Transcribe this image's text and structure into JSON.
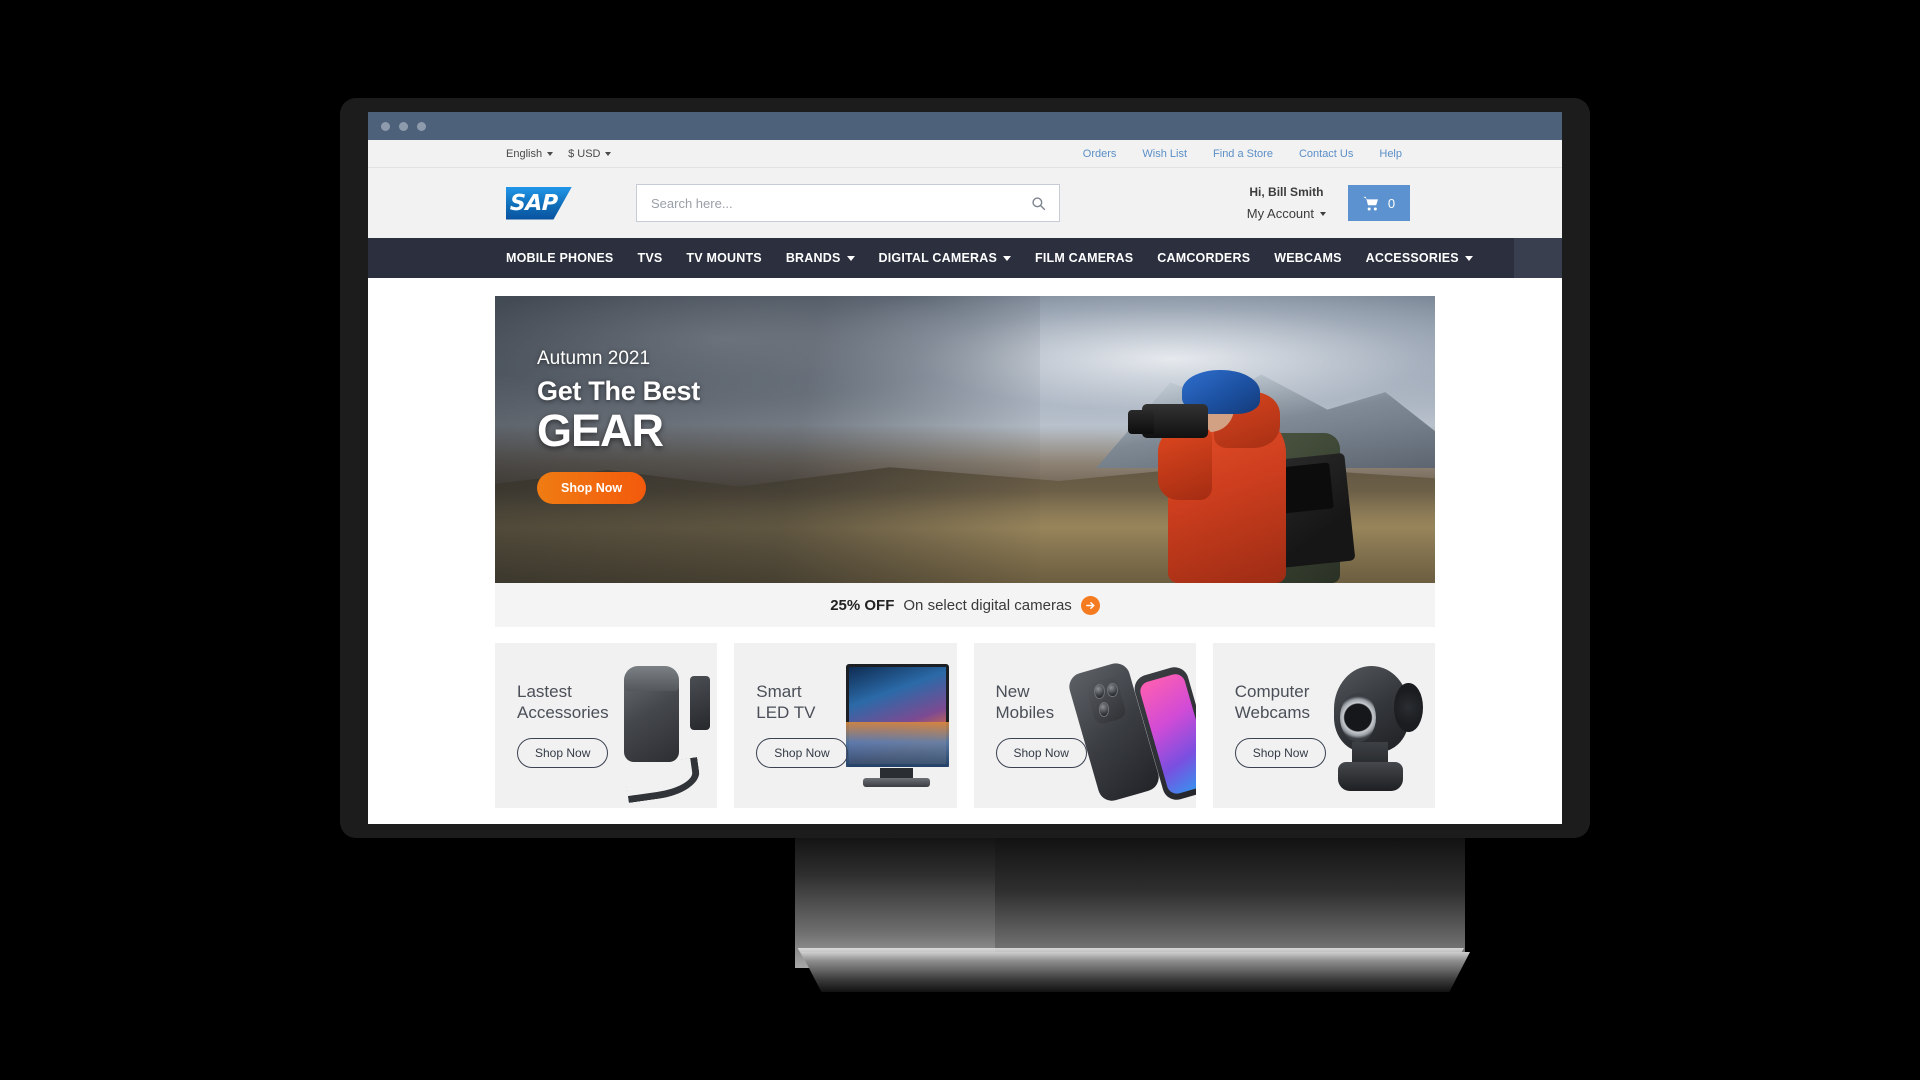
{
  "window": {
    "dots": [
      "close-dot",
      "minimize-dot",
      "maximize-dot"
    ]
  },
  "utility_bar": {
    "language": "English",
    "currency": "$ USD",
    "links": [
      {
        "label": "Orders"
      },
      {
        "label": "Wish List"
      },
      {
        "label": "Find a Store"
      },
      {
        "label": "Contact Us"
      },
      {
        "label": "Help"
      }
    ],
    "link_color": "#5b8fc7"
  },
  "header": {
    "logo_text": "SAP",
    "search": {
      "placeholder": "Search here...",
      "value": "",
      "icon": "search-icon"
    },
    "greeting": "Hi, Bill Smith",
    "account_label": "My Account",
    "cart": {
      "icon": "shopping-cart-icon",
      "count": "0",
      "color": "#5b92cf"
    }
  },
  "nav": {
    "background": "#2b2f3e",
    "items": [
      {
        "label": "MOBILE PHONES",
        "has_dropdown": false
      },
      {
        "label": "TVS",
        "has_dropdown": false
      },
      {
        "label": "TV MOUNTS",
        "has_dropdown": false
      },
      {
        "label": "BRANDS",
        "has_dropdown": true
      },
      {
        "label": "DIGITAL CAMERAS",
        "has_dropdown": true
      },
      {
        "label": "FILM CAMERAS",
        "has_dropdown": false
      },
      {
        "label": "CAMCORDERS",
        "has_dropdown": false
      },
      {
        "label": "WEBCAMS",
        "has_dropdown": false
      },
      {
        "label": "ACCESSORIES",
        "has_dropdown": true
      }
    ]
  },
  "hero": {
    "kicker": "Autumn 2021",
    "line1": "Get The Best",
    "line2": "GEAR",
    "cta_label": "Shop Now",
    "cta_color": "#f35a0c",
    "image_alt": "photographer-in-red-jacket-mountains"
  },
  "promo": {
    "strong": "25% OFF",
    "text": "On select digital cameras",
    "arrow_icon": "arrow-right-circle-icon",
    "arrow_color": "#f47b20"
  },
  "cards": [
    {
      "title": "Lastest\nAccessories",
      "button": "Shop Now",
      "art": "camera-pouch-and-strap"
    },
    {
      "title": "Smart\nLED TV",
      "button": "Shop Now",
      "art": "flat-screen-television"
    },
    {
      "title": "New\nMobiles",
      "button": "Shop Now",
      "art": "smartphones"
    },
    {
      "title": "Computer\nWebcams",
      "button": "Shop Now",
      "art": "webcam-device"
    }
  ]
}
